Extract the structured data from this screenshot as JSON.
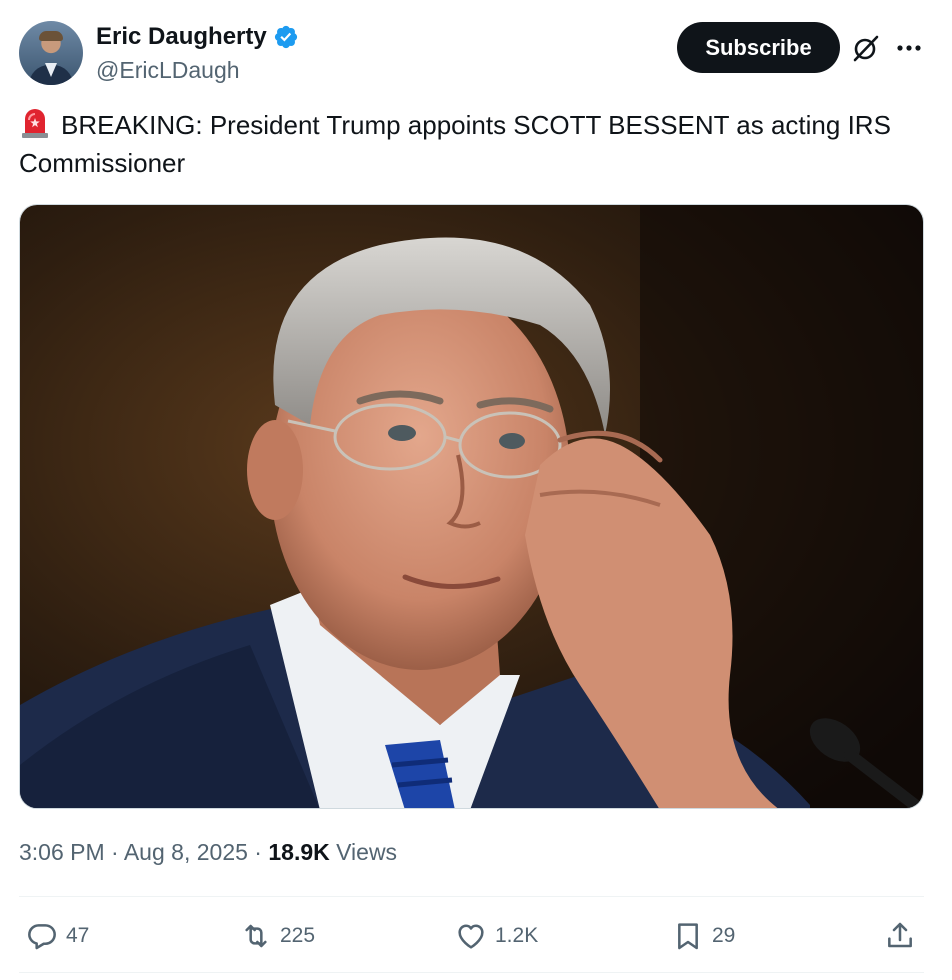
{
  "author": {
    "display_name": "Eric Daugherty",
    "handle": "@EricLDaugh",
    "verified_icon": "verified-badge-icon"
  },
  "header": {
    "subscribe_label": "Subscribe",
    "grok_icon": "grok-icon",
    "more_icon": "more-options-icon"
  },
  "tweet": {
    "emoji_icon": "police-siren-emoji",
    "text": "BREAKING: President Trump appoints SCOTT BESSENT as acting IRS Commissioner"
  },
  "meta": {
    "time": "3:06 PM",
    "sep1": "·",
    "date": "Aug 8, 2025",
    "sep2": "·",
    "views_count": "18.9K",
    "views_label": "Views"
  },
  "actions": {
    "replies": "47",
    "reposts": "225",
    "likes": "1.2K",
    "bookmarks": "29"
  },
  "colors": {
    "primary_text": "#0f1419",
    "secondary_text": "#536471",
    "verified_blue": "#1d9bf0",
    "button_dark": "#0f1419"
  }
}
